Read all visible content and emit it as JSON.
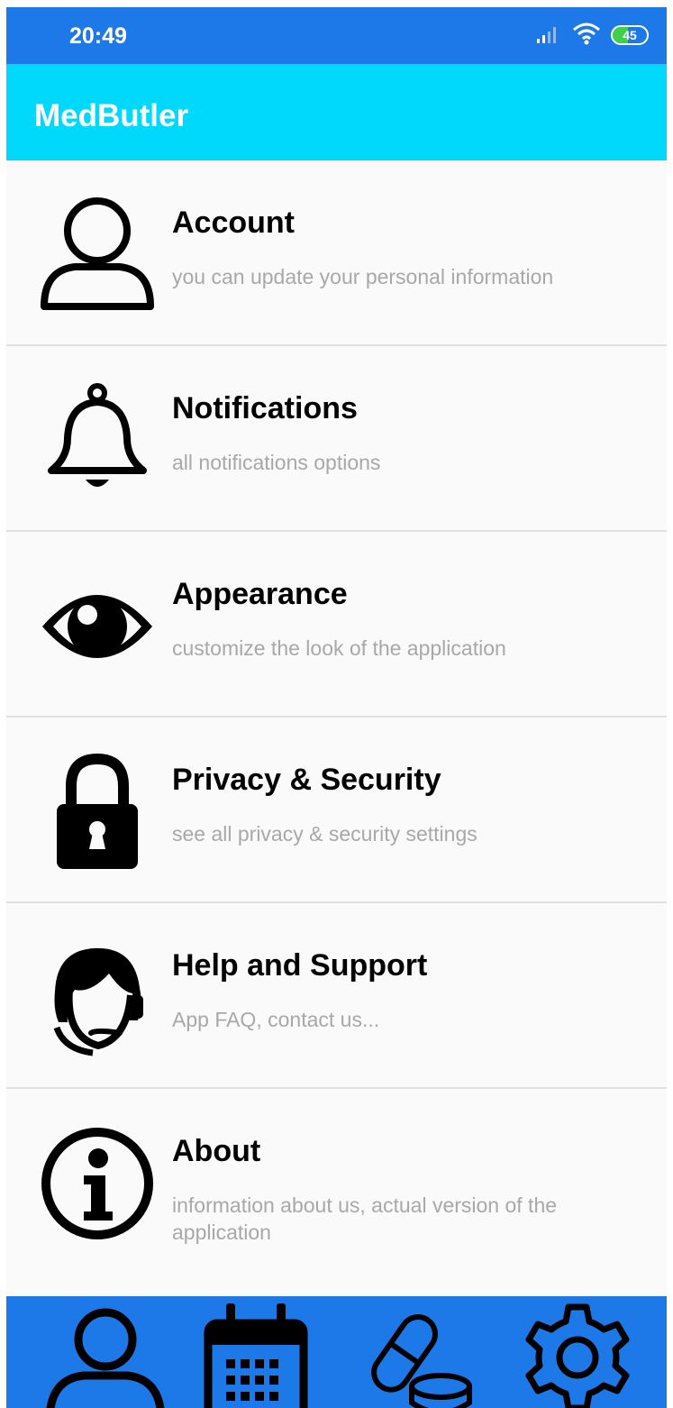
{
  "status_bar": {
    "time": "20:49",
    "battery_level": "45",
    "icons": [
      "signal-icon",
      "wifi-icon",
      "battery-icon"
    ]
  },
  "app_bar": {
    "title": "MedButler"
  },
  "settings": [
    {
      "icon": "person-icon",
      "title": "Account",
      "description": "you can update your personal information"
    },
    {
      "icon": "bell-icon",
      "title": "Notifications",
      "description": "all notifications options"
    },
    {
      "icon": "eye-icon",
      "title": "Appearance",
      "description": "customize the look of the application"
    },
    {
      "icon": "lock-icon",
      "title": "Privacy & Security",
      "description": "see all privacy & security settings"
    },
    {
      "icon": "support-agent-icon",
      "title": "Help and Support",
      "description": "App FAQ, contact us..."
    },
    {
      "icon": "info-icon",
      "title": "About",
      "description": "information about us, actual version of the application"
    }
  ],
  "bottom_nav": {
    "items": [
      "profile-icon",
      "calendar-icon",
      "pills-icon",
      "gear-icon"
    ]
  },
  "colors": {
    "status_bar": "#1e79e8",
    "app_bar": "#00d9fb",
    "list_background": "#fafafa",
    "description_text": "#a8a8a8",
    "bottom_nav": "#1e79e8"
  }
}
